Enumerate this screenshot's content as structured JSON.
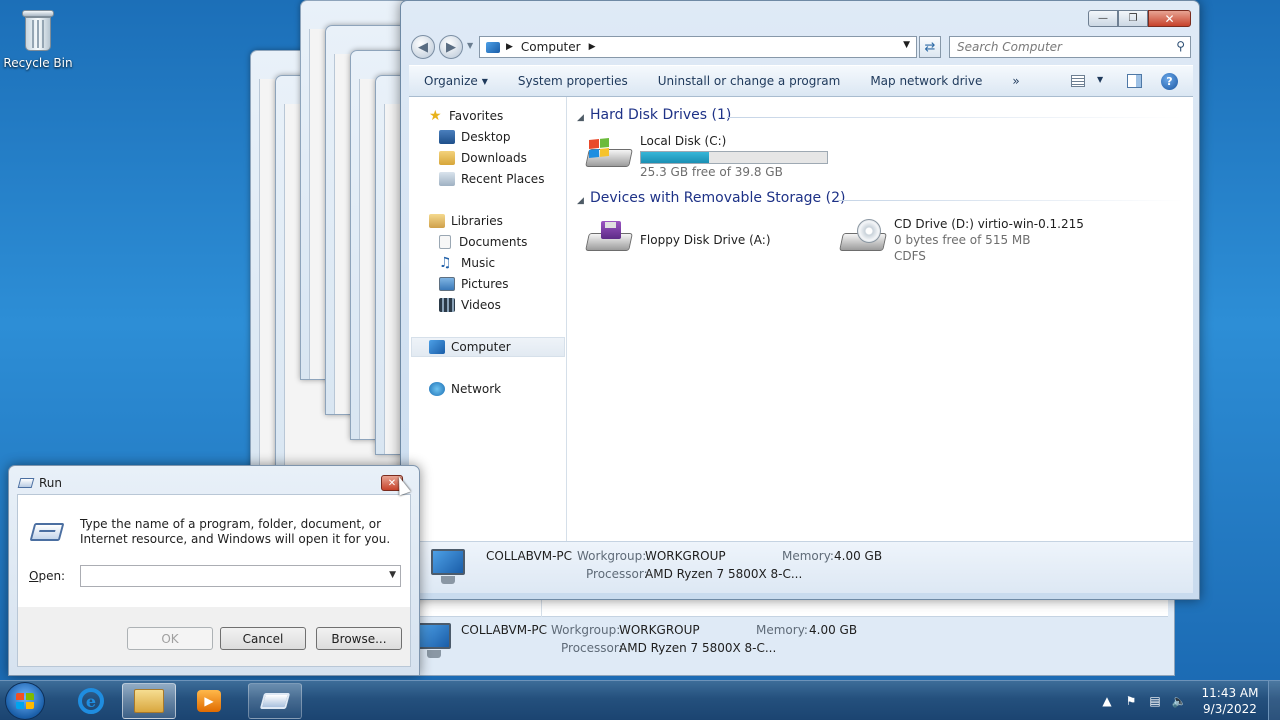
{
  "desktop": {
    "recycle_bin_label": "Recycle Bin"
  },
  "explorer": {
    "address": {
      "location": "Computer"
    },
    "search": {
      "placeholder": "Search Computer"
    },
    "commands": {
      "organize": "Organize",
      "system_properties": "System properties",
      "uninstall": "Uninstall or change a program",
      "map_drive": "Map network drive",
      "more": "»"
    },
    "nav": {
      "favorites": "Favorites",
      "desktop": "Desktop",
      "downloads": "Downloads",
      "recent_places": "Recent Places",
      "libraries": "Libraries",
      "documents": "Documents",
      "music": "Music",
      "pictures": "Pictures",
      "videos": "Videos",
      "computer": "Computer",
      "network": "Network"
    },
    "groups": {
      "hdd_title": "Hard Disk Drives (1)",
      "removable_title": "Devices with Removable Storage (2)"
    },
    "drives": {
      "local_c": {
        "name": "Local Disk (C:)",
        "free_text": "25.3 GB free of 39.8 GB",
        "used_fraction": 0.364
      },
      "floppy": {
        "name": "Floppy Disk Drive (A:)"
      },
      "cd": {
        "name": "CD Drive (D:) virtio-win-0.1.215",
        "free_text": "0 bytes free of 515 MB",
        "fs": "CDFS"
      }
    },
    "details": {
      "pc_name": "COLLABVM-PC",
      "workgroup_label": "Workgroup:",
      "workgroup": "WORKGROUP",
      "memory_label": "Memory:",
      "memory": "4.00 GB",
      "processor_label": "Processor:",
      "processor": "AMD Ryzen 7 5800X 8-C..."
    }
  },
  "background_window": {
    "pc_name": "COLLABVM-PC",
    "workgroup_label": "Workgroup:",
    "workgroup": "WORKGROUP",
    "memory_label": "Memory:",
    "memory": "4.00 GB",
    "processor_label": "Processor:",
    "processor": "AMD Ryzen 7 5800X 8-C..."
  },
  "run_dialog": {
    "title": "Run",
    "description": "Type the name of a program, folder, document, or Internet resource, and Windows will open it for you.",
    "open_label": "Open:",
    "open_value": "",
    "ok": "OK",
    "cancel": "Cancel",
    "browse": "Browse..."
  },
  "taskbar": {
    "time": "11:43 AM",
    "date": "9/3/2022"
  },
  "colors": {
    "accent": "#1e3287",
    "progress": "#2aa6cc",
    "close_button": "#c7422a"
  }
}
